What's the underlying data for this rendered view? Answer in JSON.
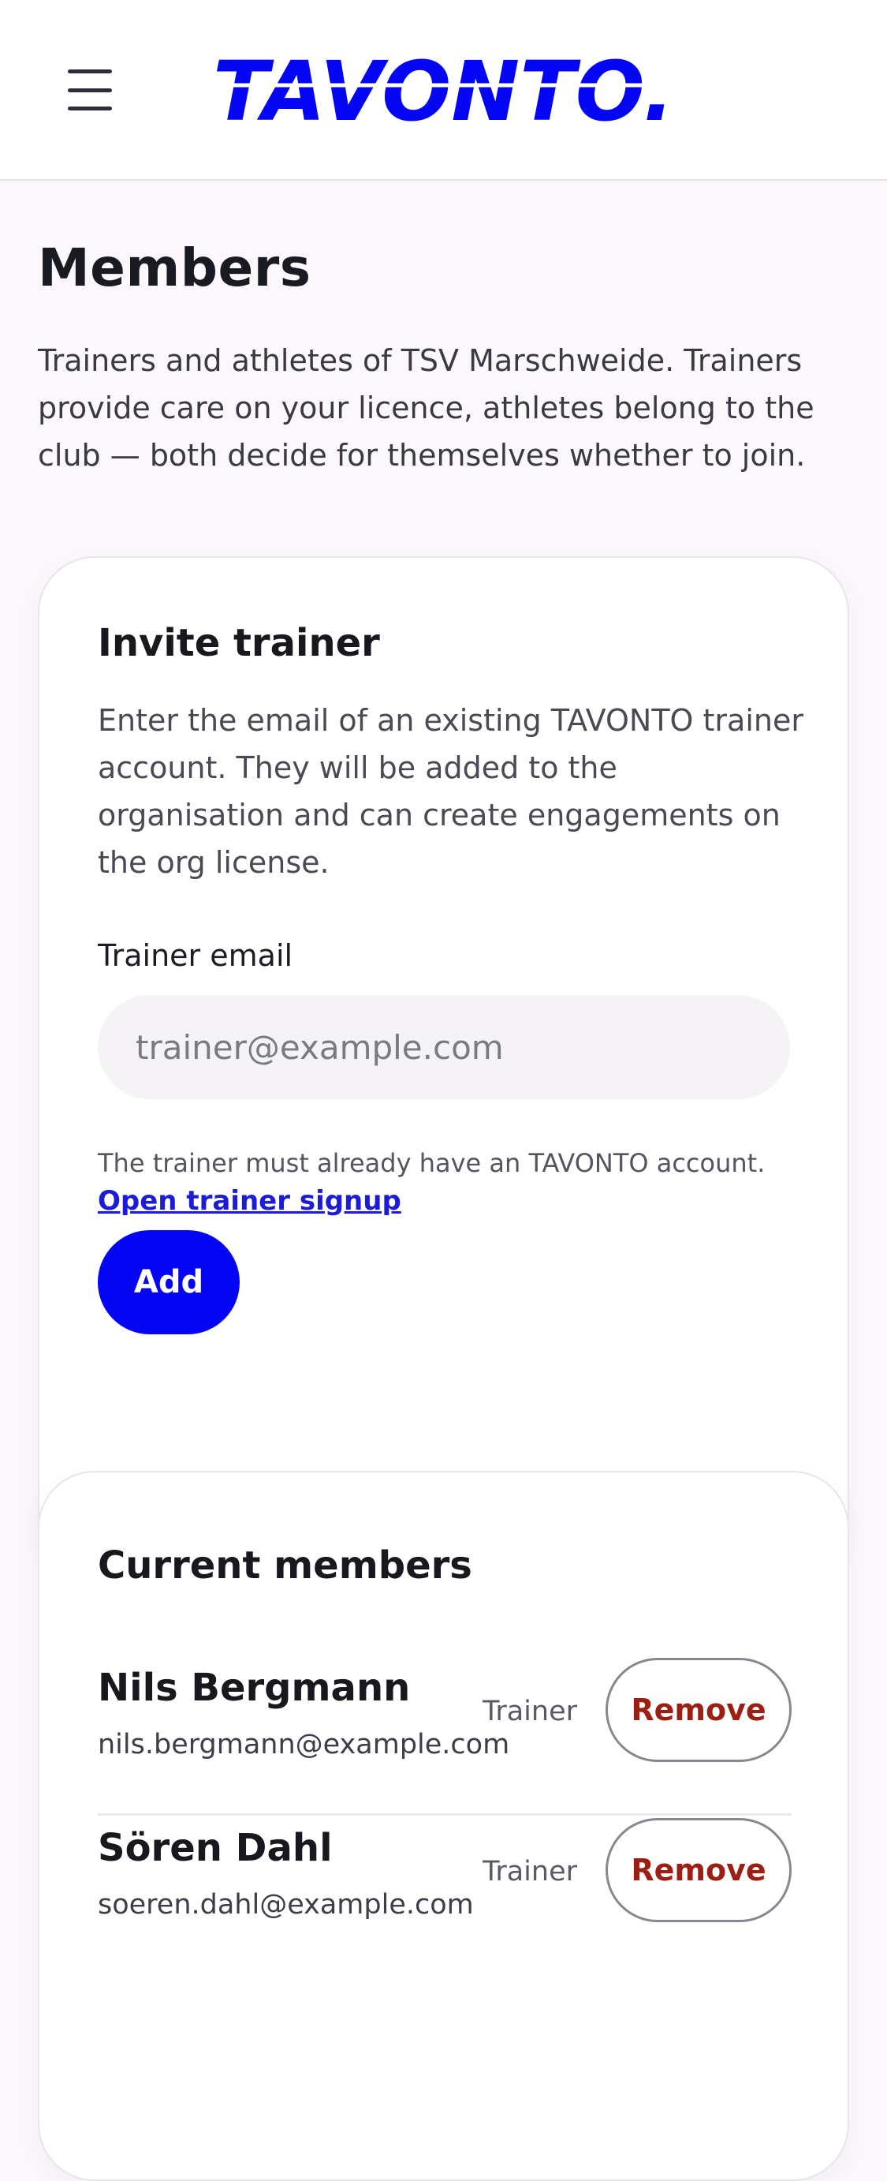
{
  "header": {
    "brand": "TAVONTO.",
    "menu_icon": "hamburger-menu-icon",
    "brand_color": "#0505f5"
  },
  "page": {
    "title": "Members",
    "description": "Trainers and athletes of TSV Marschweide. Trainers provide care on your licence, athletes belong to the club — both decide for themselves whether to join."
  },
  "invite": {
    "title": "Invite trainer",
    "description": "Enter the email of an existing TAVONTO trainer account. They will be added to the organisation and can create engagements on the org license.",
    "field_label": "Trainer email",
    "field_value": "",
    "field_placeholder": "trainer@example.com",
    "hint": "The trainer must already have an TAVONTO account.",
    "signup_link": "Open trainer signup",
    "add_label": "Add",
    "button_color": "#0505f5"
  },
  "members": {
    "title": "Current members",
    "items": [
      {
        "name": "Nils Bergmann",
        "email": "nils.bergmann@example.com",
        "role": "Trainer",
        "action": "Remove"
      },
      {
        "name": "Sören Dahl",
        "email": "soeren.dahl@example.com",
        "role": "Trainer",
        "action": "Remove"
      }
    ],
    "remove_color": "#9c1f14"
  }
}
